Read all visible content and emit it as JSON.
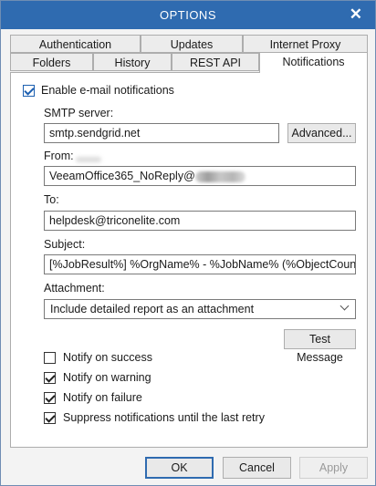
{
  "window": {
    "title": "OPTIONS"
  },
  "tabs_row1": [
    "Authentication",
    "Updates",
    "Internet Proxy"
  ],
  "tabs_row2": [
    "Folders",
    "History",
    "REST API",
    "Notifications"
  ],
  "enable_notifications": {
    "label": "Enable e-mail notifications",
    "checked": true
  },
  "smtp": {
    "label": "SMTP server:",
    "value": "smtp.sendgrid.net",
    "advanced_label": "Advanced..."
  },
  "from": {
    "label": "From:",
    "value": "VeeamOffice365_NoReply@"
  },
  "to": {
    "label": "To:",
    "value": "helpdesk@triconelite.com"
  },
  "subject": {
    "label": "Subject:",
    "value": "[%JobResult%] %OrgName% - %JobName% (%ObjectCount% o"
  },
  "attachment": {
    "label": "Attachment:",
    "value": "Include detailed report as an attachment"
  },
  "test_message_label": "Test Message",
  "notify": {
    "success": {
      "label": "Notify on success",
      "checked": false
    },
    "warning": {
      "label": "Notify on warning",
      "checked": true
    },
    "failure": {
      "label": "Notify on failure",
      "checked": true
    },
    "suppress": {
      "label": "Suppress notifications until the last retry",
      "checked": true
    }
  },
  "buttons": {
    "ok": "OK",
    "cancel": "Cancel",
    "apply": "Apply"
  },
  "icons": {
    "close": "close-icon",
    "dropdown": "chevron-down-icon"
  },
  "colors": {
    "titlebar": "#2f6bb0",
    "accent": "#1c5fb0"
  }
}
